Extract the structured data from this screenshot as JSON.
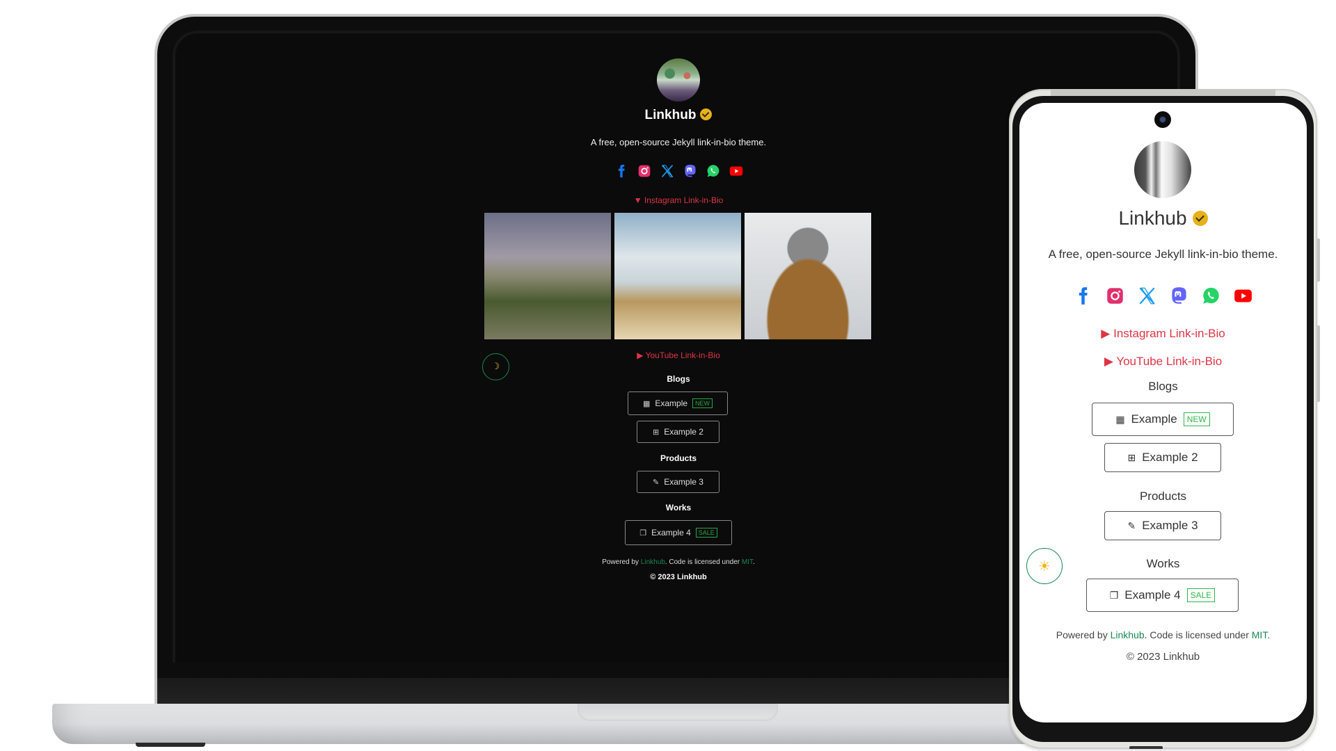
{
  "site": {
    "name": "Linkhub",
    "verified_icon": "verified-badge-icon",
    "description": "A free, open-source Jekyll link-in-bio theme."
  },
  "social": [
    {
      "name": "facebook",
      "icon": "facebook-icon",
      "color": "#1877f2"
    },
    {
      "name": "instagram",
      "icon": "instagram-icon",
      "color": "#e1306c"
    },
    {
      "name": "x",
      "icon": "x-icon",
      "color": "#1d9bf0"
    },
    {
      "name": "mastodon",
      "icon": "mastodon-icon",
      "color": "#6364ff"
    },
    {
      "name": "whatsapp",
      "icon": "whatsapp-icon",
      "color": "#25d366"
    },
    {
      "name": "youtube",
      "icon": "youtube-icon",
      "color": "#ff0000"
    }
  ],
  "collapsibles": {
    "instagram": {
      "label": "Instagram Link-in-Bio",
      "laptop_open": true,
      "phone_open": false,
      "marker_open": "▼",
      "marker_closed": "▶"
    },
    "youtube": {
      "label": "YouTube Link-in-Bio",
      "marker_closed": "▶"
    }
  },
  "instagram_photos": [
    {
      "alt": "Person sitting on a misty mountain top"
    },
    {
      "alt": "Old television in sand dunes"
    },
    {
      "alt": "Person in beanie and brown hooded jacket"
    }
  ],
  "sections": [
    {
      "heading": "Blogs",
      "links": [
        {
          "label": "Example",
          "icon": "film-icon",
          "glyph": "▦",
          "tag": "NEW"
        },
        {
          "label": "Example 2",
          "icon": "basket-icon",
          "glyph": "⊞",
          "tag": null
        }
      ]
    },
    {
      "heading": "Products",
      "links": [
        {
          "label": "Example 3",
          "icon": "pencil-icon",
          "glyph": "✎",
          "tag": null
        }
      ]
    },
    {
      "heading": "Works",
      "links": [
        {
          "label": "Example 4",
          "icon": "translate-icon",
          "glyph": "❐",
          "tag": "SALE"
        }
      ]
    }
  ],
  "footer": {
    "powered_prefix": "Powered by ",
    "powered_link": "Linkhub",
    "license_text": ". Code is licensed under ",
    "license_link": "MIT",
    "license_suffix": ".",
    "copyright": "© 2023 Linkhub"
  },
  "theme_toggle": {
    "laptop": {
      "mode": "dark",
      "icon": "moon-icon",
      "glyph": "☽"
    },
    "phone": {
      "mode": "light",
      "icon": "sun-icon",
      "glyph": "☀"
    }
  },
  "colors": {
    "accent_link": "#198754",
    "summary_red": "#dc3545",
    "tag_green": "#28a745",
    "verified_gold": "#e5b21b",
    "dark_bg": "#0b0b0b",
    "light_bg": "#ffffff"
  }
}
